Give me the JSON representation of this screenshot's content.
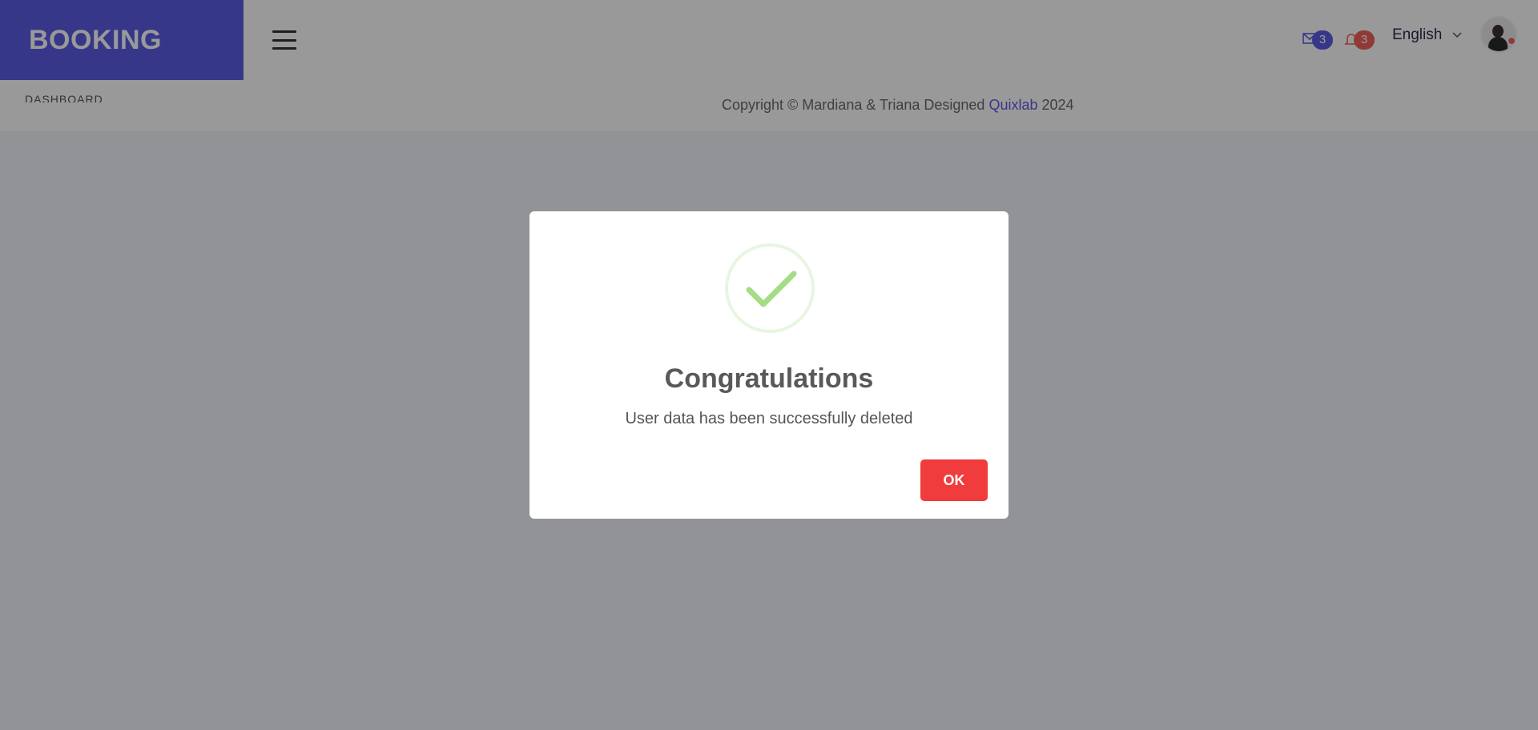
{
  "header": {
    "brand": "BOOKING",
    "messages_badge": "3",
    "notifications_badge": "3",
    "language": "English"
  },
  "subbar": {
    "dashboard_label": "DASHBOARD",
    "copyright_prefix": "Copyright © Mardiana & Triana Designed ",
    "copyright_link": "Quixlab",
    "copyright_suffix": " 2024"
  },
  "dialog": {
    "title": "Congratulations",
    "message": "User data has been successfully deleted",
    "ok_label": "OK"
  },
  "icons": {
    "menu": "hamburger-icon",
    "messages": "envelope-icon",
    "notifications": "bell-icon",
    "language_caret": "chevron-down-icon",
    "success": "checkmark-icon"
  },
  "colors": {
    "brand": "#5c5ce6",
    "ok_button": "#f03c3c",
    "success_check": "#a5dc86",
    "badge_blue": "#5c5ce6",
    "badge_red": "#f0615c"
  }
}
